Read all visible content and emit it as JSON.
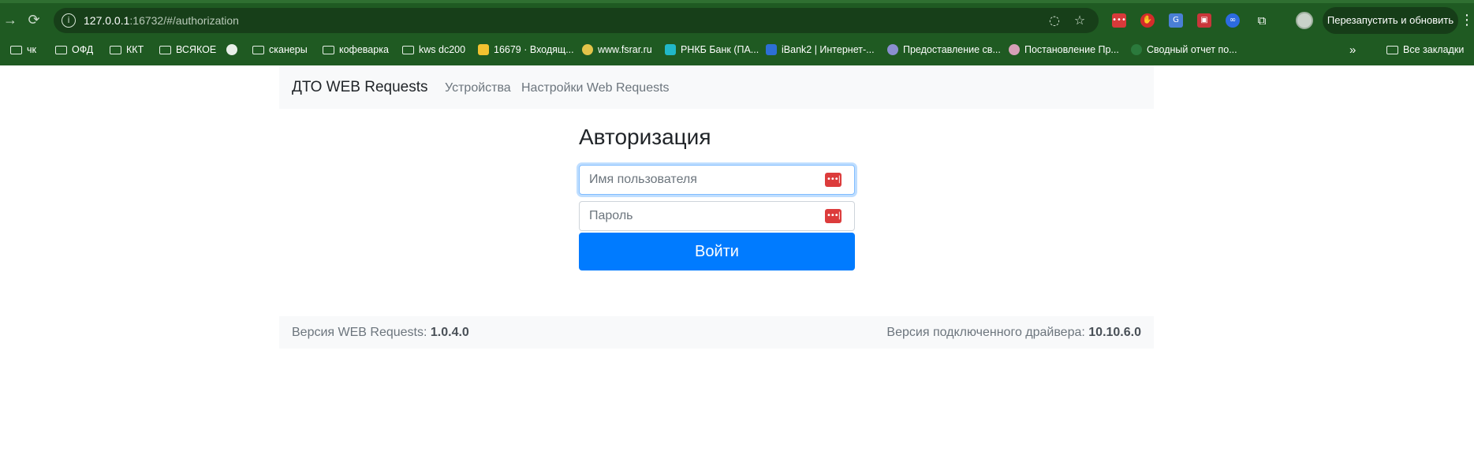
{
  "browser": {
    "url_host": "127.0.0.1",
    "url_path": ":16732/#/authorization",
    "relaunch_label": "Перезапустить и обновить",
    "bookmarks": [
      {
        "label": "чк",
        "kind": "folder"
      },
      {
        "label": "ОФД",
        "kind": "folder"
      },
      {
        "label": "ККТ",
        "kind": "folder"
      },
      {
        "label": "ВСЯКОЕ",
        "kind": "folder"
      },
      {
        "label": "",
        "kind": "globe"
      },
      {
        "label": "сканеры",
        "kind": "folder"
      },
      {
        "label": "кофеварка",
        "kind": "folder"
      },
      {
        "label": "kws dc200",
        "kind": "folder"
      },
      {
        "label": "16679 · Входящ...",
        "kind": "mail"
      },
      {
        "label": "www.fsrar.ru",
        "kind": "site"
      },
      {
        "label": "РНКБ Банк (ПА...",
        "kind": "site"
      },
      {
        "label": "iBank2 | Интернет-...",
        "kind": "site"
      },
      {
        "label": "Предоставление св...",
        "kind": "site"
      },
      {
        "label": "Постановление Пр...",
        "kind": "site"
      },
      {
        "label": "Сводный отчет по...",
        "kind": "site"
      }
    ],
    "all_bookmarks_label": "Все закладки",
    "overflow_label": "»"
  },
  "navbar": {
    "brand": "ДТО WEB Requests",
    "links": [
      "Устройства",
      "Настройки Web Requests"
    ]
  },
  "auth": {
    "title": "Авторизация",
    "username_placeholder": "Имя пользователя",
    "password_placeholder": "Пароль",
    "submit_label": "Войти"
  },
  "footer": {
    "webrequests_label": "Версия WEB Requests: ",
    "webrequests_version": "1.0.4.0",
    "driver_label": "Версия подключенного драйвера: ",
    "driver_version": "10.10.6.0"
  },
  "colors": {
    "chrome_bg": "#1f5a22",
    "primary": "#007bff",
    "navbar_bg": "#f8f9fa",
    "password_icon": "#dc3c3c"
  }
}
